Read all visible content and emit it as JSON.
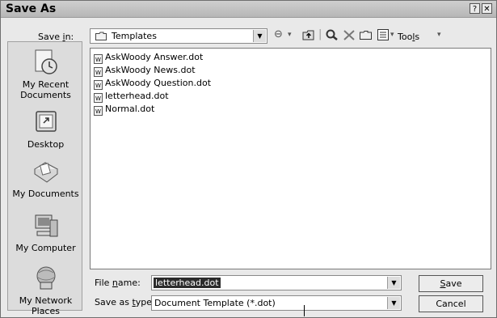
{
  "window": {
    "title": "Save As",
    "help_glyph": "?",
    "close_glyph": "✕"
  },
  "toolbar": {
    "save_in_label_a": "Save ",
    "save_in_label_u": "i",
    "save_in_label_b": "n:",
    "location": "Templates",
    "tools_label_a": "Too",
    "tools_label_u": "l",
    "tools_label_b": "s"
  },
  "places": [
    {
      "label1": "My Recent",
      "label2": "Documents",
      "icon": "recent-documents-icon"
    },
    {
      "label1": "Desktop",
      "label2": "",
      "icon": "desktop-icon"
    },
    {
      "label1": "My Documents",
      "label2": "",
      "icon": "my-documents-icon"
    },
    {
      "label1": "My Computer",
      "label2": "",
      "icon": "my-computer-icon"
    },
    {
      "label1": "My Network",
      "label2": "Places",
      "icon": "network-places-icon"
    }
  ],
  "files": [
    {
      "name": "AskWoody Answer.dot"
    },
    {
      "name": "AskWoody News.dot"
    },
    {
      "name": "AskWoody Question.dot"
    },
    {
      "name": "letterhead.dot"
    },
    {
      "name": "Normal.dot"
    }
  ],
  "form": {
    "file_name_label_a": "File ",
    "file_name_label_u": "n",
    "file_name_label_b": "ame:",
    "file_name_value": "letterhead.dot",
    "save_type_label_a": "Save as ",
    "save_type_label_u": "t",
    "save_type_label_b": "ype:",
    "save_type_value": "Document Template (*.dot)"
  },
  "buttons": {
    "save_label_u": "S",
    "save_label_b": "ave",
    "cancel_label": "Cancel"
  }
}
